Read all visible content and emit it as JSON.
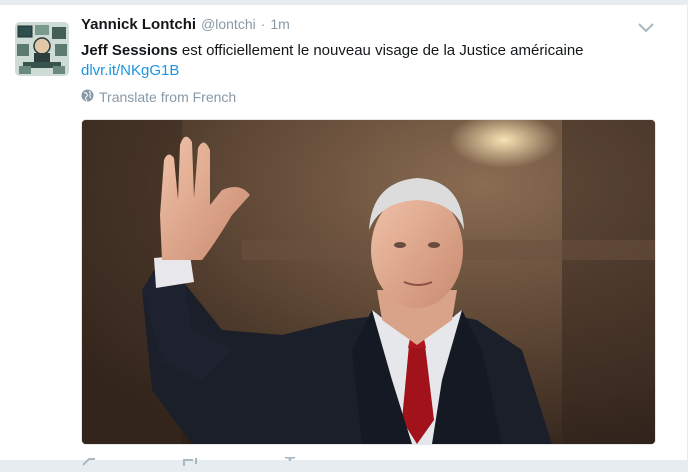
{
  "tweet": {
    "author_name": "Yannick Lontchi",
    "handle": "@lontchi",
    "separator": "·",
    "time": "1m",
    "text_bold": "Jeff Sessions",
    "text_rest": " est officiellement le nouveau visage de la Justice américaine",
    "link": "dlvr.it/NKgG1B",
    "translate_label": "Translate from French"
  },
  "icons": {
    "caret": "chevron-down-icon",
    "globe": "globe-icon",
    "reply": "reply-icon",
    "retweet": "retweet-icon",
    "like": "heart-icon"
  },
  "colors": {
    "link": "#1b95e0",
    "muted": "#8899a6",
    "text": "#14171a"
  }
}
